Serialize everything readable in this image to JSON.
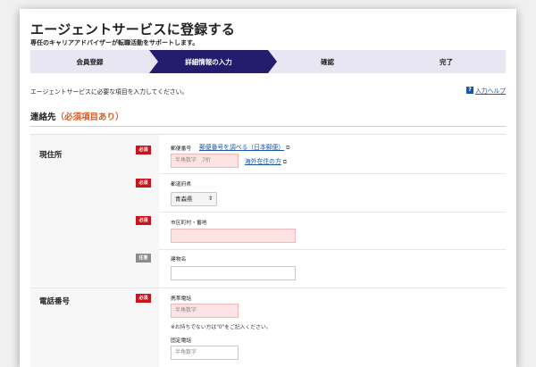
{
  "header": {
    "title": "エージェントサービスに登録する",
    "subtitle": "専任のキャリアアドバイザーが転職活動をサポートします。"
  },
  "steps": [
    {
      "label": "会員登録",
      "active": false
    },
    {
      "label": "詳細情報の入力",
      "active": true
    },
    {
      "label": "確認",
      "active": false
    },
    {
      "label": "完了",
      "active": false
    }
  ],
  "instruction": "エージェントサービスに必要な項目を入力してください。",
  "help": {
    "icon": "question-icon",
    "icon_glyph": "?",
    "label": "入力ヘルプ"
  },
  "section": {
    "title": "連絡先",
    "required_note": "（必須項目あり）"
  },
  "badges": {
    "required": "必須",
    "optional": "任意"
  },
  "address": {
    "group_label": "現住所",
    "postal": {
      "label": "郵便番号",
      "lookup_link": "郵便番号を調べる（日本郵便）",
      "placeholder": "半角数字　7桁",
      "overseas_link": "海外在住の方"
    },
    "prefecture": {
      "label": "都道府県",
      "value": "青森県"
    },
    "city": {
      "label": "市区町村・番地",
      "value": ""
    },
    "building": {
      "label": "建物名",
      "value": ""
    }
  },
  "phone": {
    "group_label": "電話番号",
    "mobile": {
      "label": "携帯電話",
      "placeholder": "半角数字",
      "note": "※お持ちでない方は\"0\"をご記入ください。"
    },
    "landline": {
      "label": "固定電話",
      "placeholder": "半角数字"
    }
  }
}
